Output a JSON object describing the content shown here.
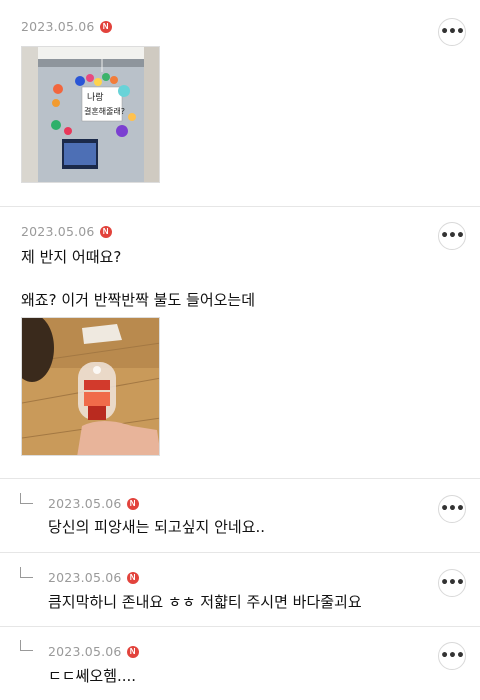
{
  "posts": [
    {
      "date": "2023.05.06",
      "badge": "N",
      "more": "•••",
      "image_alt": "photo-window-balloons"
    },
    {
      "date": "2023.05.06",
      "badge": "N",
      "more": "•••",
      "line1": "제 반지 어때요?",
      "line2": "왜죠? 이거 반짝반짝 불도 들어오는데",
      "image_alt": "photo-ring-toy"
    }
  ],
  "photo1_sign": {
    "line1": "나랑",
    "line2": "결혼해줄래?"
  },
  "replies": [
    {
      "date": "2023.05.06",
      "badge": "N",
      "more": "•••",
      "text": "당신의 피앙새는 되고싶지 안네요.."
    },
    {
      "date": "2023.05.06",
      "badge": "N",
      "more": "•••",
      "text": "큼지막하니 존내요 ㅎㅎ 저햛티 주시면 바다줄괴요"
    },
    {
      "date": "2023.05.06",
      "badge": "N",
      "more": "•••",
      "text": "ㄷㄷ쎄오헴...."
    }
  ],
  "colors": {
    "badge": "#e2433c",
    "date": "#9a9a9a",
    "divider": "#e6e6e6"
  }
}
